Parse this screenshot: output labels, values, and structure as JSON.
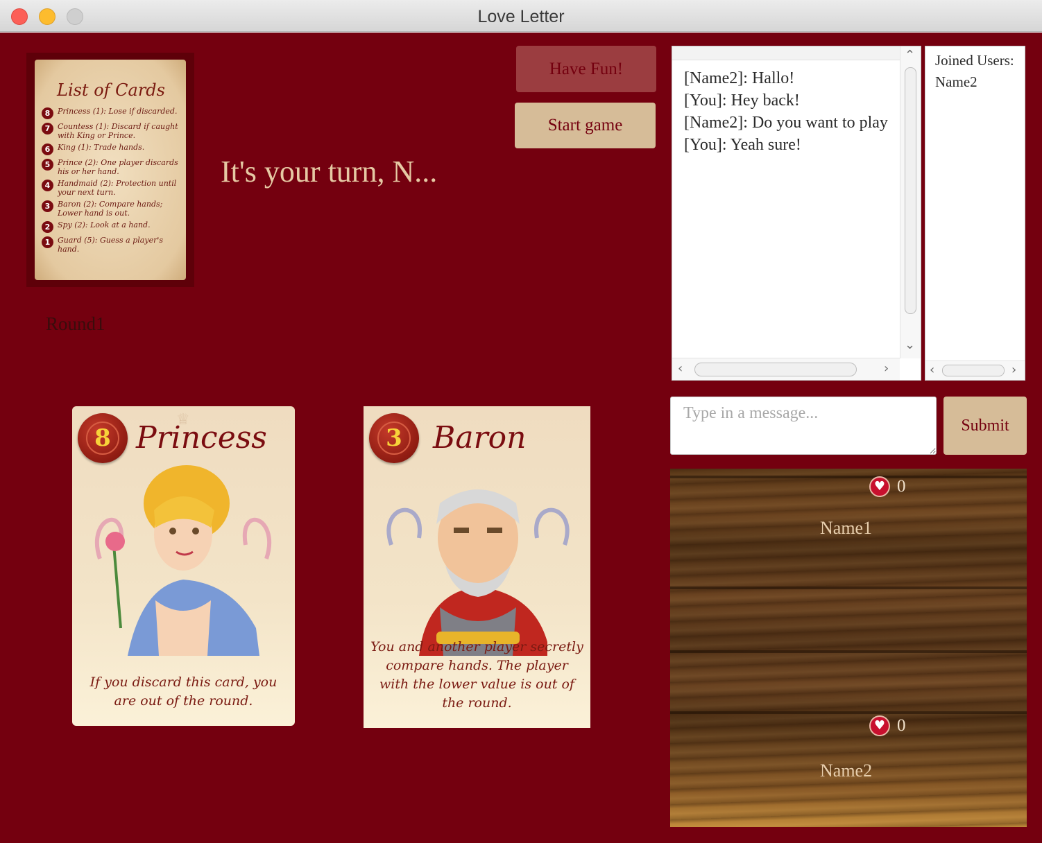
{
  "window": {
    "title": "Love Letter"
  },
  "reference_card": {
    "title": "List of Cards",
    "rows": [
      {
        "num": "8",
        "text": "Princess (1): Lose if discarded."
      },
      {
        "num": "7",
        "text": "Countess (1): Discard if caught with King or Prince."
      },
      {
        "num": "6",
        "text": "King (1): Trade hands."
      },
      {
        "num": "5",
        "text": "Prince (2): One player discards his or her hand."
      },
      {
        "num": "4",
        "text": "Handmaid (2): Protection until your next turn."
      },
      {
        "num": "3",
        "text": "Baron (2): Compare hands; Lower hand is out."
      },
      {
        "num": "2",
        "text": "Spy (2): Look at a hand."
      },
      {
        "num": "1",
        "text": "Guard (5): Guess a player's hand."
      }
    ]
  },
  "status": {
    "turn": "It's your turn, N...",
    "round": "Round1"
  },
  "buttons": {
    "have_fun": "Have Fun!",
    "start_game": "Start game",
    "submit": "Submit"
  },
  "chat": {
    "messages": [
      "[Name2]: Hallo!",
      "[You]: Hey back!",
      "[Name2]: Do you want to play",
      "[You]: Yeah sure!"
    ],
    "input_placeholder": "Type in a message..."
  },
  "users": {
    "title": "Joined Users:",
    "list": [
      "Name2"
    ]
  },
  "hand": [
    {
      "value": "8",
      "name": "Princess",
      "text": "If you discard this card, you are out of the round."
    },
    {
      "value": "3",
      "name": "Baron",
      "text": "You and another player secretly compare hands. The player with the lower value is out of the round."
    }
  ],
  "board": {
    "players": [
      {
        "name": "Name1",
        "score": "0"
      },
      {
        "name": "Name2",
        "score": "0"
      }
    ]
  },
  "colors": {
    "background": "#74000f",
    "accent": "#d6bc98",
    "button_dark": "#9b3d40",
    "heart": "#c8102e"
  }
}
